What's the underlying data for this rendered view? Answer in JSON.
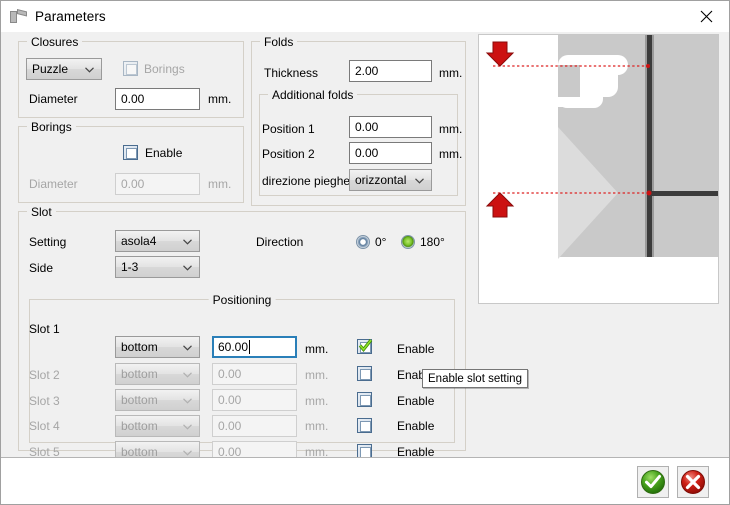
{
  "window": {
    "title": "Parameters",
    "icon": "fold-profile-icon",
    "close_label": "✕"
  },
  "closures": {
    "legend": "Closures",
    "type_value": "Puzzle",
    "borings_checkbox_label": "Borings",
    "borings_checked": false,
    "borings_enabled": false,
    "diameter_label": "Diameter",
    "diameter_value": "0.00",
    "diameter_unit": "mm."
  },
  "borings": {
    "legend": "Borings",
    "enable_label": "Enable",
    "enable_checked": false,
    "diameter_label": "Diameter",
    "diameter_value": "0.00",
    "diameter_unit": "mm.",
    "diameter_enabled": false
  },
  "folds": {
    "legend": "Folds",
    "thickness_label": "Thickness",
    "thickness_value": "2.00",
    "thickness_unit": "mm.",
    "additional": {
      "legend": "Additional folds",
      "position1_label": "Position 1",
      "position1_value": "0.00",
      "position1_unit": "mm.",
      "position2_label": "Position 2",
      "position2_value": "0.00",
      "position2_unit": "mm.",
      "direction_label": "direzione pieghe",
      "direction_value": "orizzontal"
    }
  },
  "slot": {
    "legend": "Slot",
    "setting_label": "Setting",
    "setting_value": "asola4",
    "side_label": "Side",
    "side_value": "1-3",
    "direction_label": "Direction",
    "direction_options": [
      {
        "label": "0°",
        "selected": false
      },
      {
        "label": "180°",
        "selected": true
      }
    ],
    "positioning": {
      "legend": "Positioning",
      "unit": "mm.",
      "enable_label": "Enable",
      "rows": [
        {
          "name": "Slot 1",
          "position": "bottom",
          "value": "60.00",
          "enabled": true,
          "checked": true,
          "focused": true
        },
        {
          "name": "Slot 2",
          "position": "bottom",
          "value": "0.00",
          "enabled": false,
          "checked": false,
          "focused": false
        },
        {
          "name": "Slot 3",
          "position": "bottom",
          "value": "0.00",
          "enabled": false,
          "checked": false,
          "focused": false
        },
        {
          "name": "Slot 4",
          "position": "bottom",
          "value": "0.00",
          "enabled": false,
          "checked": false,
          "focused": false
        },
        {
          "name": "Slot 5",
          "position": "bottom",
          "value": "0.00",
          "enabled": false,
          "checked": false,
          "focused": false
        }
      ]
    }
  },
  "tooltip": {
    "text": "Enable slot setting"
  },
  "preview": {
    "panel_background": "#ffffff",
    "panel_fill": "#c9c9c9",
    "wedge_fill": "#dcdcdc",
    "line_color": "#3b3b3b",
    "marker_color": "#cc1111"
  },
  "footer": {
    "ok_label": "ok-check-icon",
    "cancel_label": "cancel-cross-icon"
  },
  "colors": {
    "dialog_background": "#f0f0f0",
    "group_border": "#d4d0c8",
    "focus_border": "#2a7fb8",
    "accent_green": "#5aa80f",
    "accent_red": "#cc2222"
  }
}
